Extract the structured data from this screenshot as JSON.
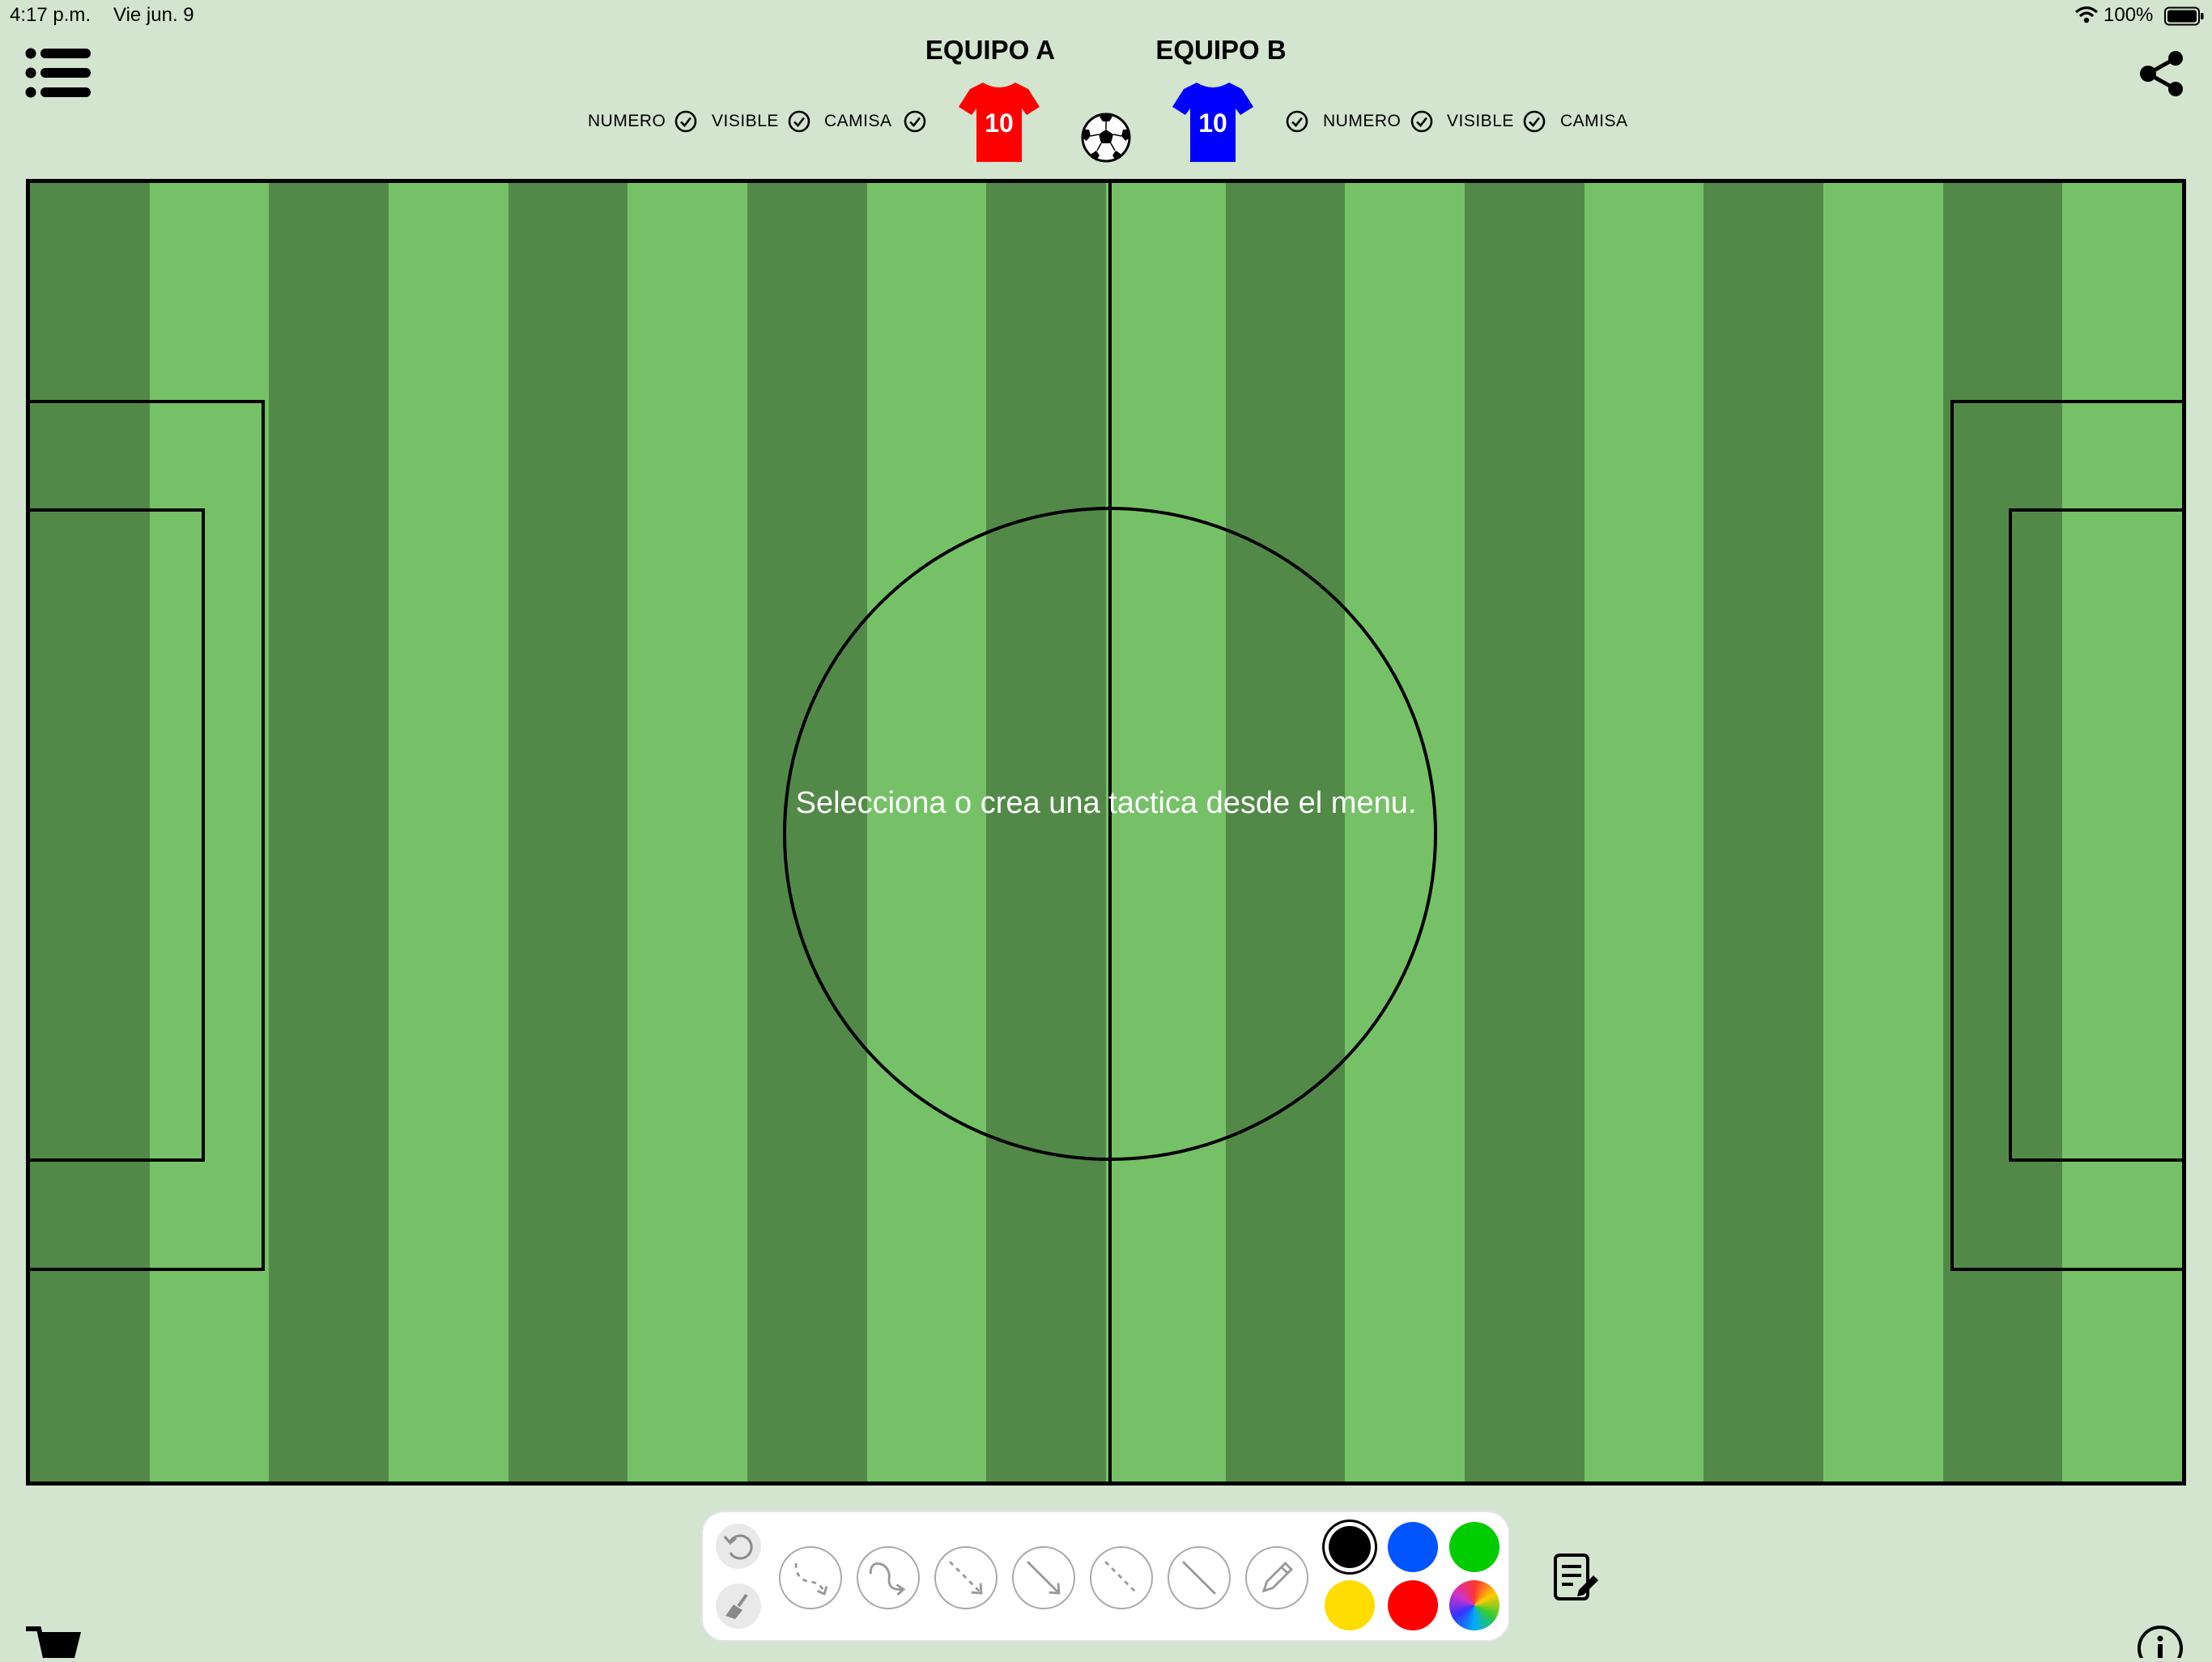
{
  "status_bar": {
    "time": "4:17 p.m.",
    "date": "Vie jun. 9",
    "battery": "100%",
    "icons": [
      "wifi-icon",
      "battery-icon"
    ]
  },
  "header": {
    "menu_icon": "list-icon",
    "share_icon": "share-icon",
    "ball_icon": "soccer-ball-icon",
    "team_a": {
      "name": "EQUIPO A",
      "jersey_number": "10",
      "jersey_color": "#ff0000",
      "options": [
        "NUMERO",
        "VISIBLE",
        "CAMISA"
      ]
    },
    "team_b": {
      "name": "EQUIPO B",
      "jersey_number": "10",
      "jersey_color": "#0000ff",
      "options": [
        "NUMERO",
        "VISIBLE",
        "CAMISA"
      ]
    }
  },
  "pitch": {
    "message": "Selecciona o crea una tactica desde el menu.",
    "stripe_dark": "#528948",
    "stripe_light": "#76c168",
    "stripe_count": 18
  },
  "toolbar": {
    "mini_tools": [
      "undo-icon",
      "clear-brush-icon"
    ],
    "line_tools": [
      "dashed-curve-arrow-icon",
      "curve-arrow-icon",
      "dashed-arrow-icon",
      "straight-arrow-icon",
      "dashed-line-icon",
      "straight-line-icon",
      "pencil-icon"
    ],
    "colors": [
      "#000000",
      "#0055ff",
      "#00cc00",
      "#ffdd00",
      "#ff0000"
    ],
    "selected_color": "#000000",
    "extra_color": "color-wheel-icon"
  },
  "footer": {
    "notes_icon": "notes-icon",
    "cart_icon": "cart-icon",
    "info_icon": "info-icon"
  }
}
